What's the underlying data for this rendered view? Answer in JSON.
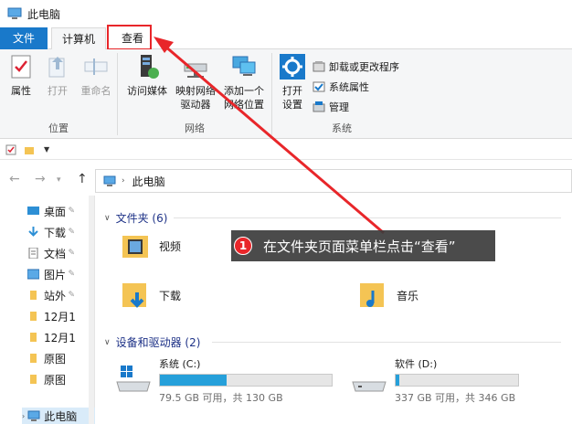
{
  "window": {
    "title": "此电脑"
  },
  "tabs": {
    "file": "文件",
    "computer": "计算机",
    "view": "查看"
  },
  "ribbon": {
    "location": {
      "label": "位置",
      "properties": "属性",
      "open": "打开",
      "rename": "重命名"
    },
    "network": {
      "label": "网络",
      "media_access": "访问媒体",
      "map_drive_1": "映射网络",
      "map_drive_2": "驱动器",
      "add_location_1": "添加一个",
      "add_location_2": "网络位置"
    },
    "system": {
      "label": "系统",
      "open_settings_1": "打开",
      "open_settings_2": "设置",
      "uninstall": "卸载或更改程序",
      "sys_props": "系统属性",
      "manage": "管理"
    }
  },
  "address": {
    "path": "此电脑"
  },
  "nav": {
    "items": [
      "桌面",
      "下载",
      "文档",
      "图片",
      "站外",
      "12月1",
      "12月1",
      "原图",
      "原图"
    ],
    "this_pc": "此电脑"
  },
  "content": {
    "folders_head": "文件夹 (6)",
    "folders": [
      {
        "name": "视频"
      },
      {
        "name": "下载"
      },
      {
        "name": "音乐"
      }
    ],
    "drives_head": "设备和驱动器 (2)",
    "drives": [
      {
        "name": "系统 (C:)",
        "detail": "79.5 GB 可用，共 130 GB",
        "used_fraction": 0.39
      },
      {
        "name": "软件 (D:)",
        "detail": "337 GB 可用，共 346 GB",
        "used_fraction": 0.03
      }
    ]
  },
  "callout": {
    "number": "1",
    "text": "在文件夹页面菜单栏点击“查看”"
  },
  "colors": {
    "accent": "#1979ca",
    "annotation": "#e8262a",
    "drive_fill": "#26a0da",
    "folder": "#f4c454"
  }
}
